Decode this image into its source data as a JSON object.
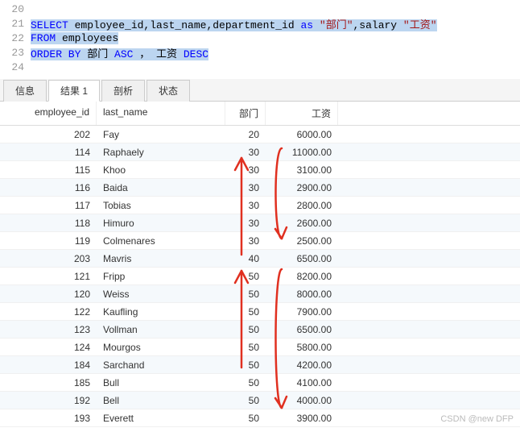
{
  "editor": {
    "lines": [
      {
        "num": "20",
        "tokens": []
      },
      {
        "num": "21",
        "tokens": [
          {
            "t": "SELECT",
            "c": "kw",
            "s": true
          },
          {
            "t": " employee_id,last_name,department_id ",
            "c": "plain",
            "s": true
          },
          {
            "t": "as",
            "c": "kw",
            "s": true
          },
          {
            "t": " ",
            "c": "plain",
            "s": true
          },
          {
            "t": "\"部门\"",
            "c": "str",
            "s": true
          },
          {
            "t": ",salary ",
            "c": "plain",
            "s": true
          },
          {
            "t": "\"工资\"",
            "c": "str",
            "s": true
          }
        ]
      },
      {
        "num": "22",
        "tokens": [
          {
            "t": "FROM",
            "c": "kw",
            "s": true
          },
          {
            "t": " employees",
            "c": "plain",
            "s": true
          }
        ]
      },
      {
        "num": "23",
        "tokens": [
          {
            "t": "ORDER BY",
            "c": "kw",
            "s": true
          },
          {
            "t": " 部门 ",
            "c": "plain",
            "s": true
          },
          {
            "t": "ASC",
            "c": "kw",
            "s": true
          },
          {
            "t": " ， 工资 ",
            "c": "plain",
            "s": true
          },
          {
            "t": "DESC",
            "c": "kw",
            "s": true
          }
        ]
      },
      {
        "num": "24",
        "tokens": []
      }
    ]
  },
  "tabs": {
    "items": [
      {
        "label": "信息",
        "active": false
      },
      {
        "label": "结果 1",
        "active": true
      },
      {
        "label": "剖析",
        "active": false
      },
      {
        "label": "状态",
        "active": false
      }
    ]
  },
  "grid": {
    "columns": [
      {
        "key": "employee_id",
        "label": "employee_id"
      },
      {
        "key": "last_name",
        "label": "last_name"
      },
      {
        "key": "dept",
        "label": "部门"
      },
      {
        "key": "salary",
        "label": "工资"
      }
    ],
    "rows": [
      {
        "employee_id": "202",
        "last_name": "Fay",
        "dept": "20",
        "salary": "6000.00"
      },
      {
        "employee_id": "114",
        "last_name": "Raphaely",
        "dept": "30",
        "salary": "11000.00"
      },
      {
        "employee_id": "115",
        "last_name": "Khoo",
        "dept": "30",
        "salary": "3100.00"
      },
      {
        "employee_id": "116",
        "last_name": "Baida",
        "dept": "30",
        "salary": "2900.00"
      },
      {
        "employee_id": "117",
        "last_name": "Tobias",
        "dept": "30",
        "salary": "2800.00"
      },
      {
        "employee_id": "118",
        "last_name": "Himuro",
        "dept": "30",
        "salary": "2600.00"
      },
      {
        "employee_id": "119",
        "last_name": "Colmenares",
        "dept": "30",
        "salary": "2500.00"
      },
      {
        "employee_id": "203",
        "last_name": "Mavris",
        "dept": "40",
        "salary": "6500.00"
      },
      {
        "employee_id": "121",
        "last_name": "Fripp",
        "dept": "50",
        "salary": "8200.00"
      },
      {
        "employee_id": "120",
        "last_name": "Weiss",
        "dept": "50",
        "salary": "8000.00"
      },
      {
        "employee_id": "122",
        "last_name": "Kaufling",
        "dept": "50",
        "salary": "7900.00"
      },
      {
        "employee_id": "123",
        "last_name": "Vollman",
        "dept": "50",
        "salary": "6500.00"
      },
      {
        "employee_id": "124",
        "last_name": "Mourgos",
        "dept": "50",
        "salary": "5800.00"
      },
      {
        "employee_id": "184",
        "last_name": "Sarchand",
        "dept": "50",
        "salary": "4200.00"
      },
      {
        "employee_id": "185",
        "last_name": "Bull",
        "dept": "50",
        "salary": "4100.00"
      },
      {
        "employee_id": "192",
        "last_name": "Bell",
        "dept": "50",
        "salary": "4000.00"
      },
      {
        "employee_id": "193",
        "last_name": "Everett",
        "dept": "50",
        "salary": "3900.00"
      }
    ]
  },
  "watermark": "CSDN @new DFP",
  "annotations": {
    "color": "#e03020"
  }
}
